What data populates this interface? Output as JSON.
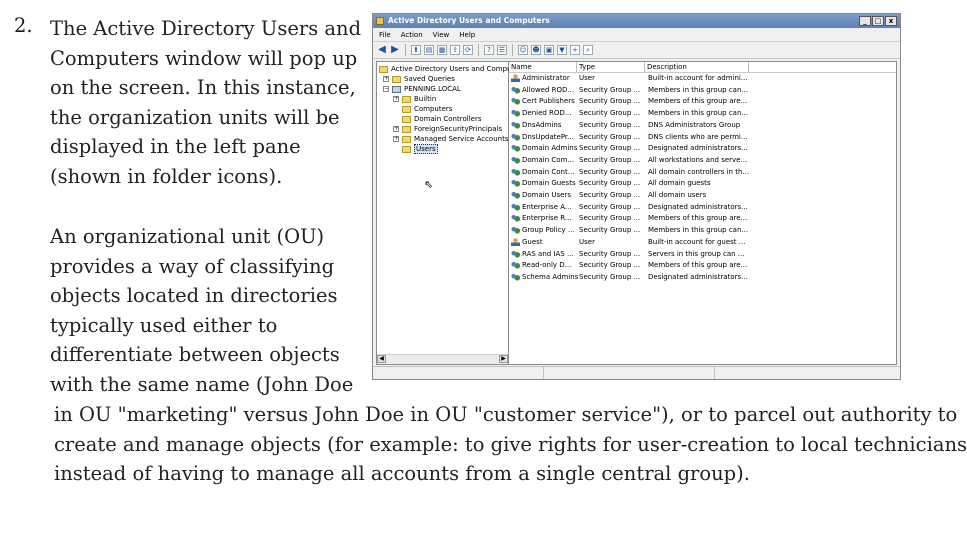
{
  "document": {
    "step_number": "2.",
    "para1_lines": [
      "The Active Directory Users and",
      "Computers window will pop up",
      "on the screen. In this instance,",
      "the organization units will be",
      "displayed in the left pane",
      "(shown in folder icons)."
    ],
    "para2_lines": [
      "An organizational unit (OU)",
      "provides a way of classifying",
      "objects located in directories",
      "typically used either to",
      "differentiate between objects",
      "with the same name (John Doe"
    ],
    "para3_lines": [
      "in OU \"marketing\" versus John Doe in OU \"customer service\"), or to parcel out authority to",
      "create and manage objects (for example: to give rights for user-creation to local technicians",
      "instead of having to manage all accounts from a single central group)."
    ]
  },
  "window": {
    "title": "Active Directory Users and Computers",
    "buttons": {
      "minimize": "_",
      "maximize": "□",
      "close": "x"
    },
    "menu": [
      "File",
      "Action",
      "View",
      "Help"
    ],
    "toolbar_icons": [
      "back-icon",
      "forward-icon",
      "up-folder-icon",
      "console-tree-icon",
      "properties-icon",
      "export-icon",
      "refresh-icon",
      "help-icon",
      "details-icon",
      "new-user-icon",
      "new-group-icon",
      "new-ou-icon",
      "filter-icon",
      "add-to-group-icon",
      "find-icon"
    ],
    "tree": [
      {
        "label": "Active Directory Users and Comput",
        "expander": "",
        "icon": "aduc"
      },
      {
        "label": "Saved Queries",
        "expander": "+",
        "icon": "folder"
      },
      {
        "label": "PENNING.LOCAL",
        "expander": "−",
        "icon": "domain"
      },
      {
        "label": "Builtin",
        "expander": "+",
        "icon": "folder"
      },
      {
        "label": "Computers",
        "expander": "",
        "icon": "folder"
      },
      {
        "label": "Domain Controllers",
        "expander": "",
        "icon": "folder"
      },
      {
        "label": "ForeignSecurityPrincipals",
        "expander": "+",
        "icon": "folder"
      },
      {
        "label": "Managed Service Accounts",
        "expander": "+",
        "icon": "folder"
      },
      {
        "label": "Users",
        "expander": "",
        "icon": "folder",
        "selected": true
      }
    ],
    "columns": [
      "Name",
      "Type",
      "Description"
    ],
    "rows": [
      {
        "name": "Administrator",
        "type": "User",
        "desc": "Built-in account for admini...",
        "icon": "user"
      },
      {
        "name": "Allowed ROD...",
        "type": "Security Group ...",
        "desc": "Members in this group can...",
        "icon": "group"
      },
      {
        "name": "Cert Publishers",
        "type": "Security Group ...",
        "desc": "Members of this group are...",
        "icon": "group"
      },
      {
        "name": "Denied ROD...",
        "type": "Security Group ...",
        "desc": "Members in this group can...",
        "icon": "group"
      },
      {
        "name": "DnsAdmins",
        "type": "Security Group ...",
        "desc": "DNS Administrators Group",
        "icon": "group"
      },
      {
        "name": "DnsUpdatePr...",
        "type": "Security Group ...",
        "desc": "DNS clients who are permi...",
        "icon": "group"
      },
      {
        "name": "Domain Admins",
        "type": "Security Group ...",
        "desc": "Designated administrators...",
        "icon": "group"
      },
      {
        "name": "Domain Com...",
        "type": "Security Group ...",
        "desc": "All workstations and serve...",
        "icon": "group"
      },
      {
        "name": "Domain Cont...",
        "type": "Security Group ...",
        "desc": "All domain controllers in th...",
        "icon": "group"
      },
      {
        "name": "Domain Guests",
        "type": "Security Group ...",
        "desc": "All domain guests",
        "icon": "group"
      },
      {
        "name": "Domain Users",
        "type": "Security Group ...",
        "desc": "All domain users",
        "icon": "group"
      },
      {
        "name": "Enterprise A...",
        "type": "Security Group ...",
        "desc": "Designated administrators...",
        "icon": "group"
      },
      {
        "name": "Enterprise R...",
        "type": "Security Group ...",
        "desc": "Members of this group are...",
        "icon": "group"
      },
      {
        "name": "Group Policy ...",
        "type": "Security Group ...",
        "desc": "Members in this group can...",
        "icon": "group"
      },
      {
        "name": "Guest",
        "type": "User",
        "desc": "Built-in account for guest ...",
        "icon": "user"
      },
      {
        "name": "RAS and IAS ...",
        "type": "Security Group ...",
        "desc": "Servers in this group can ...",
        "icon": "group"
      },
      {
        "name": "Read-only D...",
        "type": "Security Group ...",
        "desc": "Members of this group are...",
        "icon": "group"
      },
      {
        "name": "Schema Admins",
        "type": "Security Group ...",
        "desc": "Designated administrators...",
        "icon": "group"
      }
    ]
  }
}
